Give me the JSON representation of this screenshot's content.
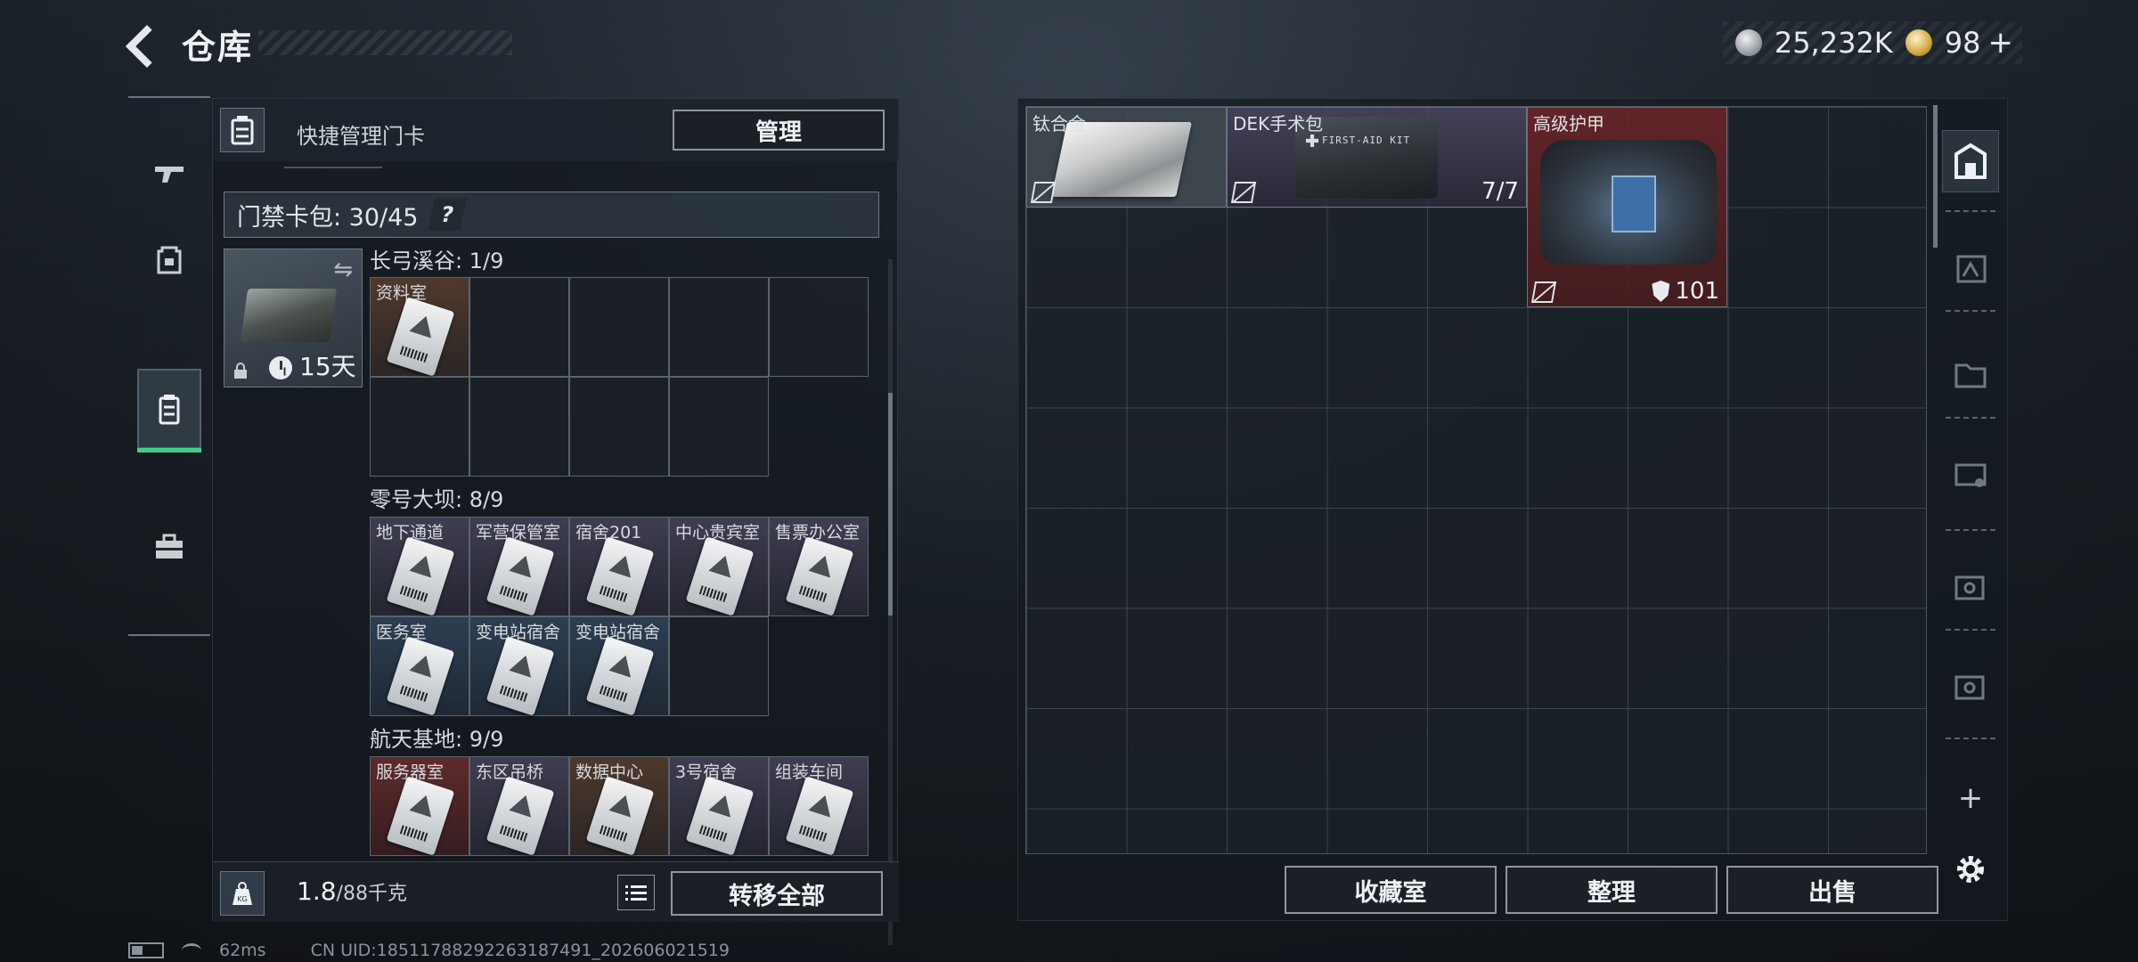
{
  "header": {
    "title": "仓库"
  },
  "currency": [
    {
      "icon": "silver-coin-icon",
      "value": "25,232K"
    },
    {
      "icon": "gold-coin-icon",
      "value": "98",
      "suffix": "+"
    }
  ],
  "left_panel": {
    "header_label": "快捷管理门卡",
    "manage_label": "管理",
    "cardpack_label": "门禁卡包: 30/45",
    "help_label": "?",
    "card_case": {
      "days": "15天"
    },
    "sections": [
      {
        "label": "长弓溪谷: 1/9",
        "cards": [
          "资料室"
        ]
      },
      {
        "label": "零号大坝: 8/9",
        "cards": [
          "地下通道",
          "军营保管室",
          "宿舍201",
          "中心贵宾室",
          "售票办公室",
          "医务室",
          "变电站宿舍",
          "变电站宿舍"
        ]
      },
      {
        "label": "航天基地: 9/9",
        "cards": [
          "服务器室",
          "东区吊桥",
          "数据中心",
          "3号宿舍",
          "组装车间"
        ]
      }
    ],
    "weight": {
      "current": "1.8",
      "max": "/88千克"
    },
    "transfer_all_label": "转移全部"
  },
  "stash": {
    "items": [
      {
        "name": "钛合金",
        "count": ""
      },
      {
        "name": "DEK手术包",
        "count": "7/7"
      },
      {
        "name": "高级护甲",
        "count": "101"
      }
    ]
  },
  "actions": {
    "collection_label": "收藏室",
    "organize_label": "整理",
    "sell_label": "出售"
  },
  "right_rail": {
    "add_label": "+"
  },
  "status": {
    "ping": "62ms",
    "uid": "CN UID:18511788292263187491_202606021519"
  },
  "colors": {
    "accent_green": "#3cd28c",
    "brown_rarity": "#684632",
    "purple_rarity": "#524c66",
    "blue_rarity": "#384e68",
    "red_rarity": "#783030"
  }
}
